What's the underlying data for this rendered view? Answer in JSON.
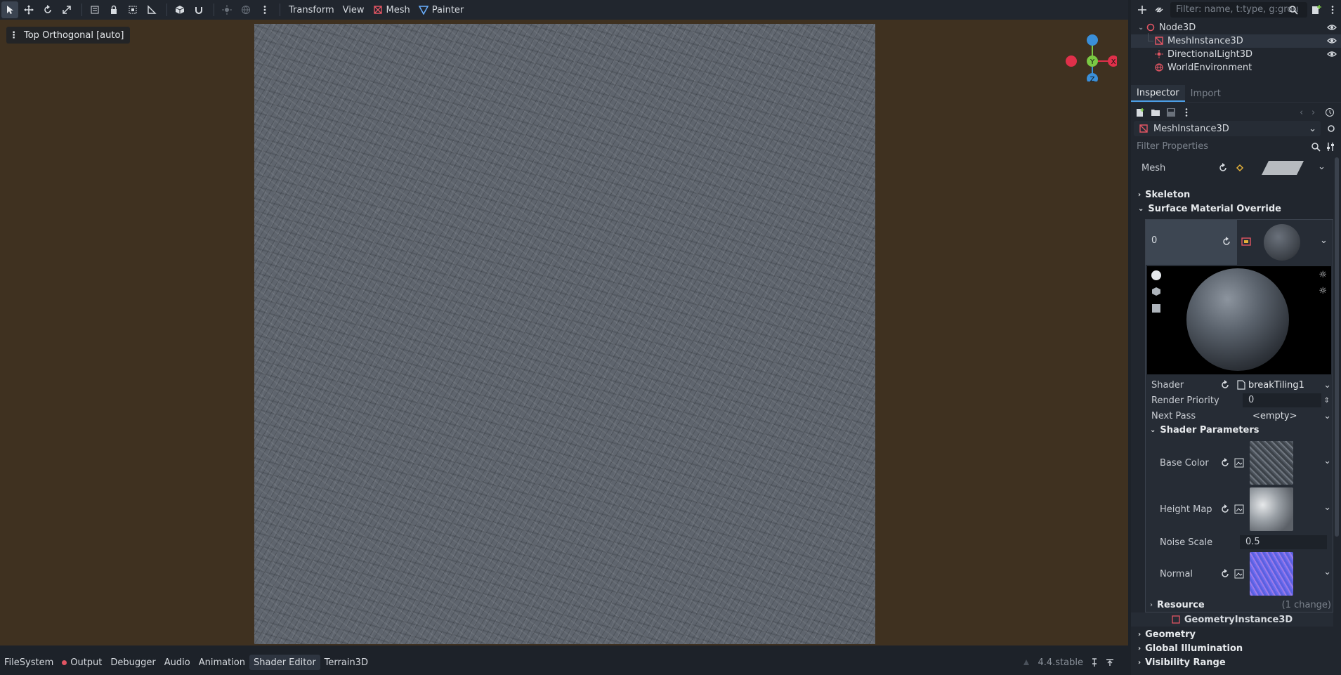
{
  "toolbar": {
    "transform_label": "Transform",
    "view_label": "View",
    "mesh_label": "Mesh",
    "painter_label": "Painter"
  },
  "viewport": {
    "label": "Top Orthogonal [auto]",
    "gizmo": {
      "y": "Y",
      "x": "X",
      "z": "Z"
    }
  },
  "bottom_tabs": [
    {
      "label": "FileSystem"
    },
    {
      "label": "Output"
    },
    {
      "label": "Debugger"
    },
    {
      "label": "Audio"
    },
    {
      "label": "Animation"
    },
    {
      "label": "Shader Editor"
    },
    {
      "label": "Terrain3D"
    }
  ],
  "version": "4.4.stable",
  "scene": {
    "filter_placeholder": "Filter: name, t:type, g:grou",
    "nodes": [
      {
        "label": "Node3D"
      },
      {
        "label": "MeshInstance3D"
      },
      {
        "label": "DirectionalLight3D"
      },
      {
        "label": "WorldEnvironment"
      }
    ]
  },
  "inspector": {
    "tabs": [
      "Inspector",
      "Import"
    ],
    "object": "MeshInstance3D",
    "filter_placeholder": "Filter Properties",
    "mesh_label": "Mesh",
    "skeleton_label": "Skeleton",
    "surface_override_label": "Surface Material Override",
    "slot_index": "0",
    "shader_label": "Shader",
    "shader_value": "breakTiling1",
    "render_priority_label": "Render Priority",
    "render_priority_value": "0",
    "next_pass_label": "Next Pass",
    "next_pass_value": "<empty>",
    "shader_params_label": "Shader Parameters",
    "base_color_label": "Base Color",
    "height_map_label": "Height Map",
    "noise_scale_label": "Noise Scale",
    "noise_scale_value": "0.5",
    "normal_label": "Normal",
    "resource_label": "Resource",
    "resource_changes": "(1 change)",
    "geometry_instance_label": "GeometryInstance3D",
    "geometry_label": "Geometry",
    "gi_label": "Global Illumination",
    "visibility_label": "Visibility Range"
  },
  "colors": {
    "accent": "#4c9fe6",
    "viewport_bg": "#3f3120",
    "axis_x": "#e0304a",
    "axis_y": "#7ac943",
    "axis_z": "#3a8fd9"
  }
}
